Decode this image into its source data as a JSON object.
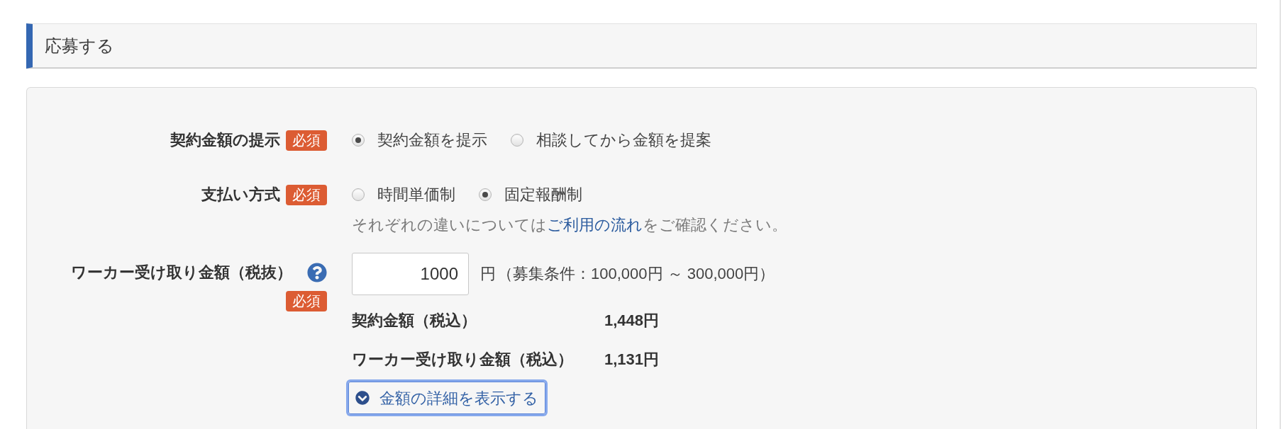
{
  "section": {
    "title": "応募する"
  },
  "form": {
    "rows": [
      {
        "kind": "radio",
        "label": "契約金額の提示",
        "badge": "必須",
        "options": [
          {
            "label": "契約金額を提示",
            "selected": true
          },
          {
            "label": "相談してから金額を提案",
            "selected": false
          }
        ]
      },
      {
        "kind": "radio",
        "label": "支払い方式",
        "badge": "必須",
        "options": [
          {
            "label": "時間単価制",
            "selected": false
          },
          {
            "label": "固定報酬制",
            "selected": true
          }
        ],
        "note": {
          "before": "それぞれの違いについては",
          "link": "ご利用の流れ",
          "after": "をご確認ください。"
        }
      },
      {
        "kind": "amount",
        "label": "ワーカー受け取り金額（税抜）",
        "help": true,
        "badge": "必須",
        "input": {
          "value": "1000"
        },
        "unit": "円",
        "condition": "（募集条件：100,000円 ～ 300,000円）",
        "summary": [
          {
            "label": "契約金額（税込）",
            "value": "1,448円"
          },
          {
            "label": "ワーカー受け取り金額（税込）",
            "value": "1,131円"
          }
        ],
        "details_button": {
          "label": "金額の詳細を表示する",
          "focused": true
        }
      }
    ]
  }
}
